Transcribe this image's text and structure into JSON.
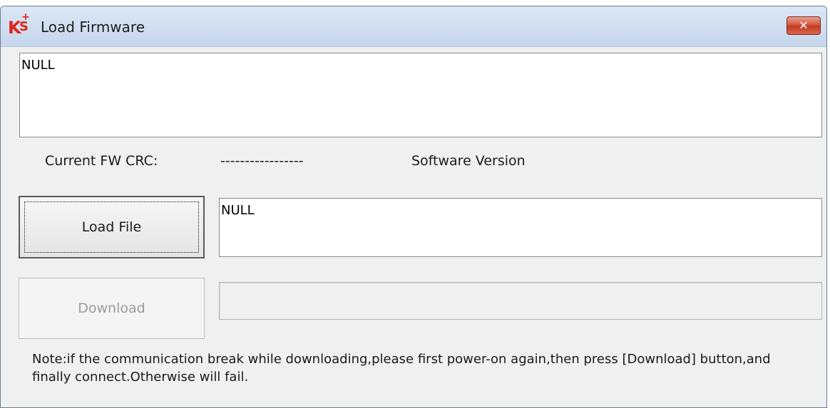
{
  "window": {
    "title": "Load Firmware",
    "close_glyph": "✕",
    "logo": {
      "letters": [
        "K",
        "S",
        "+"
      ],
      "color": "#e2231a"
    }
  },
  "log_box": {
    "value": "NULL"
  },
  "crc": {
    "label": "Current FW CRC:",
    "value": "-----------------"
  },
  "software_version": {
    "label": "Software Version"
  },
  "load_button": {
    "label": "Load File"
  },
  "file_box": {
    "value": "NULL"
  },
  "download_button": {
    "label": "Download",
    "enabled": false
  },
  "progress": {
    "value": 0
  },
  "note": {
    "text": "Note:if the communication break while downloading,please first power-on again,then press [Download] button,and finally connect.Otherwise will fail."
  },
  "colors": {
    "close_button": "#d4503a",
    "titlebar": "#c6d7ec",
    "dialog_bg": "#f0f0f0"
  }
}
